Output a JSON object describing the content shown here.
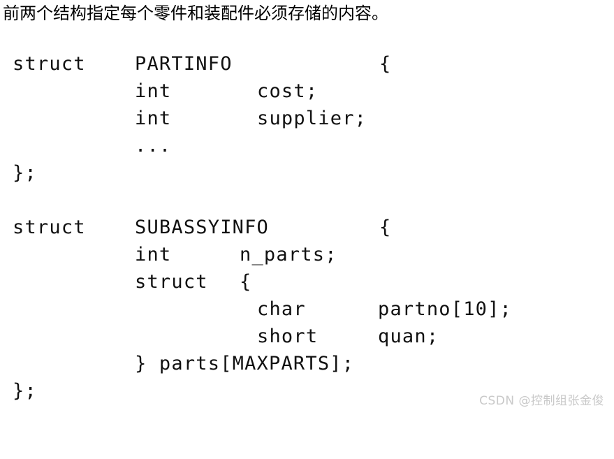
{
  "page": {
    "background_color": "#ffffff",
    "text_color": "#000000",
    "watermark_color": "#c9c9c9"
  },
  "caption": {
    "text": "前两个结构指定每个零件和装配件必须存储的内容。"
  },
  "code": {
    "language": "c",
    "lines": [
      {
        "id": "line-1",
        "col1": "struct",
        "col2": "PARTINFO",
        "col3": "",
        "col4": "",
        "brace": "{"
      },
      {
        "id": "line-2",
        "col1": "",
        "col2": "int",
        "col3": "",
        "col4": "cost;",
        "brace": ""
      },
      {
        "id": "line-3",
        "col1": "",
        "col2": "int",
        "col3": "",
        "col4": "supplier;",
        "brace": ""
      },
      {
        "id": "line-4",
        "col1": "",
        "col2": "...",
        "col3": "",
        "col4": "",
        "brace": ""
      },
      {
        "id": "line-5",
        "col1": "};",
        "col2": "",
        "col3": "",
        "col4": "",
        "brace": ""
      },
      {
        "id": "line-6",
        "col1": "",
        "col2": "",
        "col3": "",
        "col4": "",
        "brace": ""
      },
      {
        "id": "line-7",
        "col1": "struct",
        "col2": "SUBASSYINFO",
        "col3": "",
        "col4": "",
        "brace": "{"
      },
      {
        "id": "line-8",
        "col1": "",
        "col2": "int",
        "col3": "n_parts;",
        "col4": "",
        "brace": ""
      },
      {
        "id": "line-9",
        "col1": "",
        "col2": "struct",
        "col3": "{",
        "col4": "",
        "brace": ""
      },
      {
        "id": "line-10",
        "col1": "",
        "col2": "",
        "col3": "",
        "col4": "char",
        "brace": "partno[10];"
      },
      {
        "id": "line-11",
        "col1": "",
        "col2": "",
        "col3": "",
        "col4": "short",
        "brace": "quan;"
      },
      {
        "id": "line-12",
        "col1": "",
        "col2": "} parts[MAXPARTS];",
        "col3": "",
        "col4": "",
        "brace": ""
      },
      {
        "id": "line-13",
        "col1": "};",
        "col2": "",
        "col3": "",
        "col4": "",
        "brace": ""
      }
    ],
    "raw": "struct    PARTINFO        {\n          int      cost;\n          int      supplier;\n          ...\n};\n\nstruct    SUBASSYINFO     {\n          int      n_parts;\n          struct   {\n                   char     partno[10];\n                   short    quan;\n          } parts[MAXPARTS];\n};"
  },
  "watermark": {
    "text": "CSDN @控制组张金俊"
  }
}
